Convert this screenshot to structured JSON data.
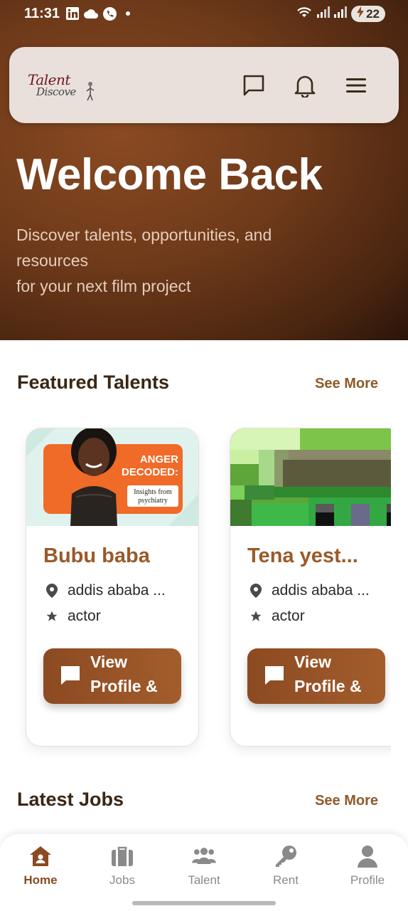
{
  "status_bar": {
    "time": "11:31",
    "battery": "22"
  },
  "header": {
    "logo_line1": "Talent",
    "logo_line2": "Discove"
  },
  "hero": {
    "title": "Welcome Back",
    "subtitle_lines": [
      "Discover talents, opportunities, and",
      "resources",
      "for your next film project"
    ]
  },
  "featured": {
    "title": "Featured Talents",
    "see_more": "See More",
    "cards": [
      {
        "name": "Bubu baba",
        "location": "addis ababa ...",
        "role": "actor",
        "button_label": "View Profile & Message",
        "image_text": {
          "line1": "ANGER",
          "line2": "DECODED:",
          "tag1": "Insights from",
          "tag2": "psychiatry"
        }
      },
      {
        "name": "Tena yest...",
        "location": "addis ababa ...",
        "role": "actor",
        "button_label": "View Profile & Message"
      }
    ]
  },
  "jobs": {
    "title": "Latest Jobs",
    "see_more": "See More"
  },
  "nav": {
    "items": [
      {
        "label": "Home",
        "icon": "home-icon",
        "active": true
      },
      {
        "label": "Jobs",
        "icon": "briefcase-icon",
        "active": false
      },
      {
        "label": "Talent",
        "icon": "people-icon",
        "active": false
      },
      {
        "label": "Rent",
        "icon": "key-icon",
        "active": false
      },
      {
        "label": "Profile",
        "icon": "person-icon",
        "active": false
      }
    ]
  },
  "colors": {
    "accent": "#8a4a22",
    "card_name": "#9a5a28",
    "see_more": "#8d5a2b"
  }
}
